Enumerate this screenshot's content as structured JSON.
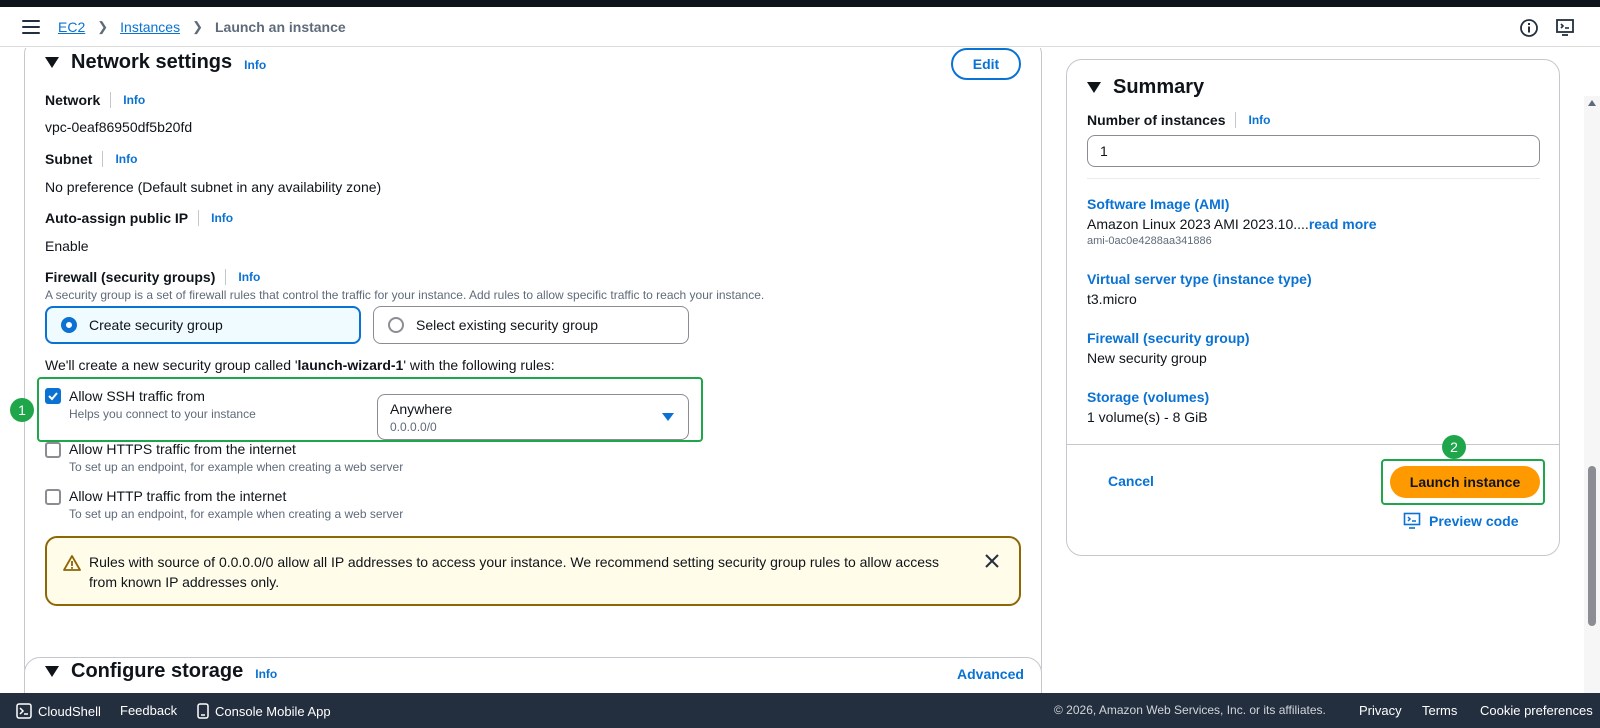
{
  "breadcrumb": {
    "items": [
      {
        "label": "EC2"
      },
      {
        "label": "Instances"
      },
      {
        "label": "Launch an instance"
      }
    ]
  },
  "network": {
    "title": "Network settings",
    "info": "Info",
    "edit_label": "Edit",
    "network_label": "Network",
    "network_value": "vpc-0eaf86950df5b20fd",
    "subnet_label": "Subnet",
    "subnet_value": "No preference (Default subnet in any availability zone)",
    "public_ip_label": "Auto-assign public IP",
    "public_ip_value": "Enable",
    "firewall_label": "Firewall (security groups)",
    "firewall_desc": "A security group is a set of firewall rules that control the traffic for your instance. Add rules to allow specific traffic to reach your instance.",
    "create_sg_label": "Create security group",
    "select_sg_label": "Select existing security group",
    "rules_intro_prefix": "We'll create a new security group called '",
    "rules_intro_name": "launch-wizard-1",
    "rules_intro_suffix": "' with the following rules:",
    "ssh_title": "Allow SSH traffic from",
    "ssh_desc": "Helps you connect to your instance",
    "ssh_source_value": "Anywhere",
    "ssh_source_sub": "0.0.0.0/0",
    "https_title": "Allow HTTPS traffic from the internet",
    "https_desc": "To set up an endpoint, for example when creating a web server",
    "http_title": "Allow HTTP traffic from the internet",
    "http_desc": "To set up an endpoint, for example when creating a web server",
    "warning_line1": "Rules with source of 0.0.0.0/0 allow all IP addresses to access your instance. We recommend setting security group rules to allow access",
    "warning_line2": "from known IP addresses only."
  },
  "storage": {
    "title": "Configure storage",
    "info": "Info",
    "advanced_label": "Advanced"
  },
  "summary": {
    "title": "Summary",
    "instances_label": "Number of instances",
    "info": "Info",
    "instances_value": "1",
    "ami_label": "Software Image (AMI)",
    "ami_value": "Amazon Linux 2023 AMI 2023.10....",
    "ami_read_more": "read more",
    "ami_id": "ami-0ac0e4288aa341886",
    "type_label": "Virtual server type (instance type)",
    "type_value": "t3.micro",
    "firewall_label": "Firewall (security group)",
    "firewall_value": "New security group",
    "storage_label": "Storage (volumes)",
    "storage_value": "1 volume(s) - 8 GiB",
    "cancel_label": "Cancel",
    "launch_label": "Launch instance",
    "preview_label": "Preview code"
  },
  "badges": {
    "one": "1",
    "two": "2"
  },
  "footer": {
    "cloudshell": "CloudShell",
    "feedback": "Feedback",
    "mobile_app": "Console Mobile App",
    "copyright": "© 2026, Amazon Web Services, Inc. or its affiliates.",
    "privacy": "Privacy",
    "terms": "Terms",
    "cookies": "Cookie preferences"
  },
  "colors": {
    "link": "#0972d3",
    "launch": "#ff9900",
    "highlight": "#1fa64a",
    "warning_border": "#8d6605"
  }
}
